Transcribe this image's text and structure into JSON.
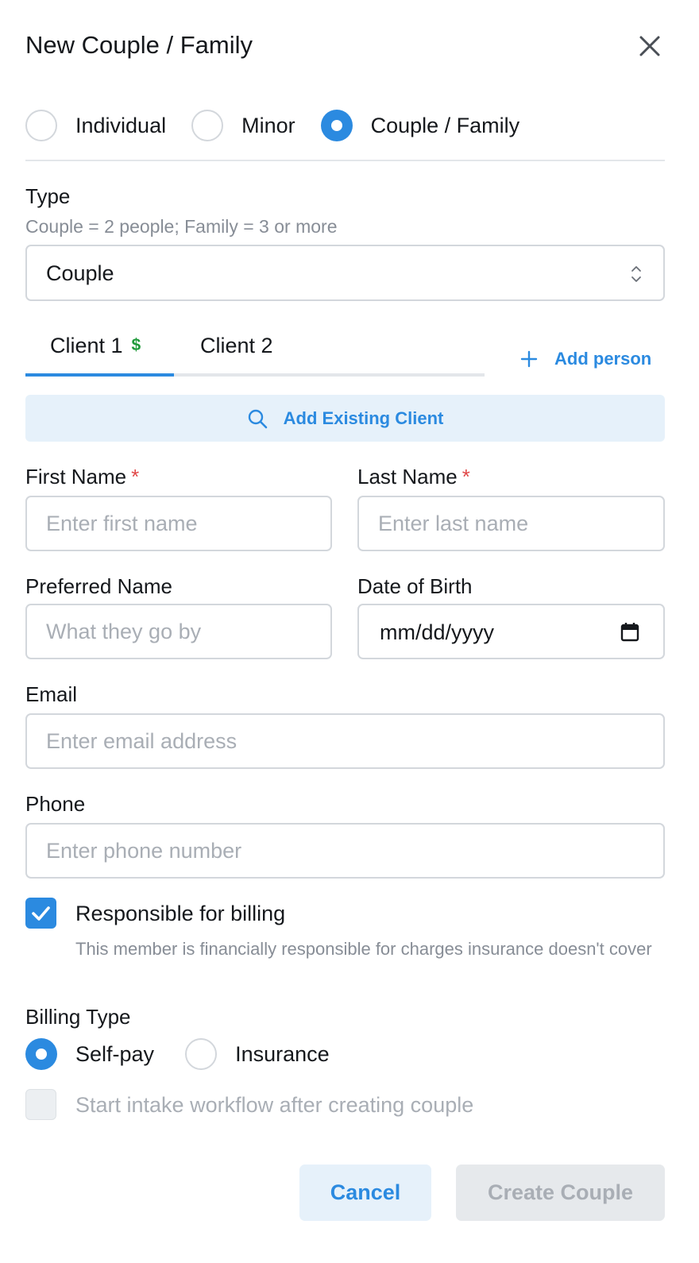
{
  "dialog": {
    "title": "New Couple / Family",
    "close_icon": "close-icon"
  },
  "client_mode": {
    "options": [
      {
        "label": "Individual",
        "selected": false
      },
      {
        "label": "Minor",
        "selected": false
      },
      {
        "label": "Couple / Family",
        "selected": true
      }
    ]
  },
  "type_field": {
    "label": "Type",
    "hint": "Couple = 2 people; Family = 3 or more",
    "value": "Couple",
    "icon": "chevron-up-down-icon"
  },
  "client_tabs": {
    "tabs": [
      {
        "label": "Client 1",
        "active": true,
        "billing_icon": "dollar-icon",
        "billing_glyph": "$"
      },
      {
        "label": "Client 2",
        "active": false
      }
    ],
    "add_person_label": "Add person",
    "add_person_icon": "plus-icon"
  },
  "add_existing": {
    "label": "Add Existing Client",
    "icon": "search-icon"
  },
  "form": {
    "first_name": {
      "label": "First Name",
      "required_mark": "*",
      "placeholder": "Enter first name",
      "value": ""
    },
    "last_name": {
      "label": "Last Name",
      "required_mark": "*",
      "placeholder": "Enter last name",
      "value": ""
    },
    "preferred_name": {
      "label": "Preferred Name",
      "placeholder": "What they go by",
      "value": ""
    },
    "dob": {
      "label": "Date of Birth",
      "value": "mm/dd/yyyy",
      "icon": "calendar-icon"
    },
    "email": {
      "label": "Email",
      "placeholder": "Enter email address",
      "value": ""
    },
    "phone": {
      "label": "Phone",
      "placeholder": "Enter phone number",
      "value": ""
    }
  },
  "billing_responsibility": {
    "checked": true,
    "label": "Responsible for billing",
    "description": "This member is financially responsible for charges insurance doesn't cover"
  },
  "billing_type": {
    "label": "Billing Type",
    "options": [
      {
        "label": "Self-pay",
        "selected": true
      },
      {
        "label": "Insurance",
        "selected": false
      }
    ]
  },
  "intake": {
    "checked": false,
    "disabled": true,
    "label": "Start intake workflow after creating couple"
  },
  "footer": {
    "cancel_label": "Cancel",
    "create_label": "Create Couple",
    "create_disabled": true
  },
  "colors": {
    "accent": "#2b8ae0",
    "required": "#e04848",
    "billing_dollar": "#1f9a3a",
    "muted_text": "#878d96",
    "border": "#d3d7dc"
  }
}
